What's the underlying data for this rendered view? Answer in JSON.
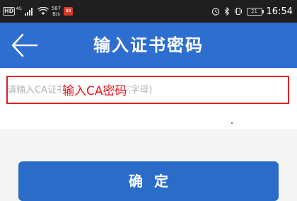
{
  "status_bar": {
    "hd_label": "HD",
    "network_label": "4G",
    "speed_value": "587",
    "speed_unit": "B/s",
    "app_badge": "88",
    "battery_level": "21",
    "time": "16:54",
    "icons": [
      "signal-icon",
      "wifi-icon",
      "alarm-icon",
      "bluetooth-icon",
      "vibrate-icon",
      "battery-icon"
    ]
  },
  "header": {
    "back_icon": "arrow-left-icon",
    "title": "输入证书密码"
  },
  "form": {
    "password_placeholder": "请输入CA证书密码(6位数字或字母)",
    "annotation": "输入CA密码"
  },
  "footer": {
    "confirm_label": "确定"
  },
  "colors": {
    "header_bg": "#2d6ed0",
    "button_bg": "#2b6cc9",
    "annotation_red": "#e02020"
  }
}
